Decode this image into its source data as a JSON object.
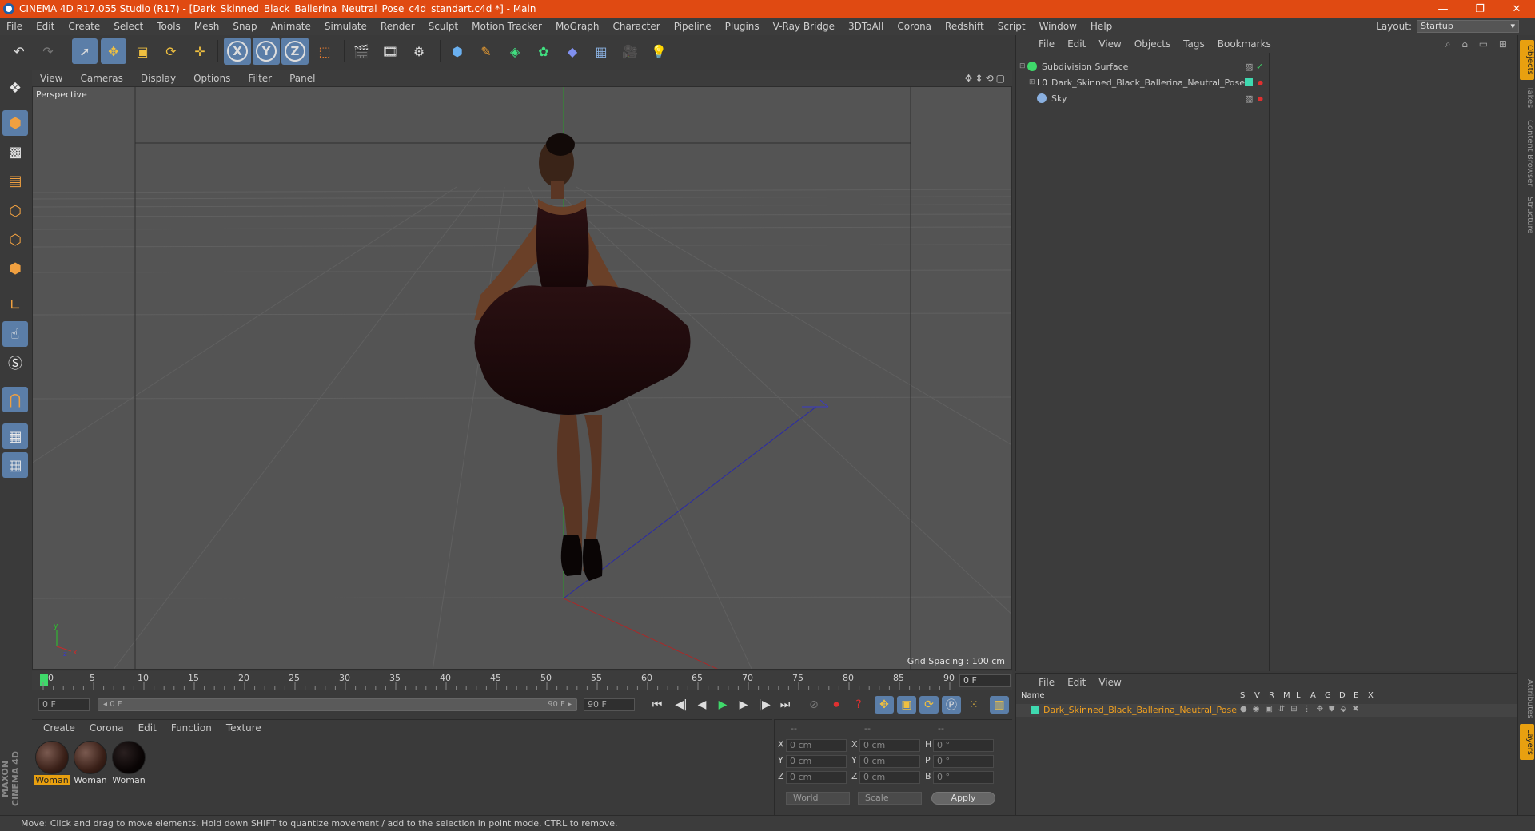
{
  "window": {
    "title": "CINEMA 4D R17.055 Studio (R17) - [Dark_Skinned_Black_Ballerina_Neutral_Pose_c4d_standart.c4d *] - Main",
    "minimize": "—",
    "restore": "❐",
    "close": "✕"
  },
  "menubar": {
    "items": [
      "File",
      "Edit",
      "Create",
      "Select",
      "Tools",
      "Mesh",
      "Snap",
      "Animate",
      "Simulate",
      "Render",
      "Sculpt",
      "Motion Tracker",
      "MoGraph",
      "Character",
      "Pipeline",
      "Plugins",
      "V-Ray Bridge",
      "3DToAll",
      "Corona",
      "Redshift",
      "Script",
      "Window",
      "Help"
    ],
    "layout_label": "Layout:",
    "layout_value": "Startup"
  },
  "viewport": {
    "menu": [
      "View",
      "Cameras",
      "Display",
      "Options",
      "Filter",
      "Panel"
    ],
    "nav_icons": "✥⇕⟲▢",
    "camera_label": "Perspective",
    "grid_spacing": "Grid Spacing : 100 cm"
  },
  "timeline": {
    "ticks": [
      "0",
      "5",
      "10",
      "15",
      "20",
      "25",
      "30",
      "35",
      "40",
      "45",
      "50",
      "55",
      "60",
      "65",
      "70",
      "75",
      "80",
      "85",
      "90"
    ],
    "current_frame": "0 F"
  },
  "transport": {
    "start_field": "0 F",
    "range_start": "◂ 0 F",
    "range_end": "90 F ▸",
    "end_field": "90 F"
  },
  "material_manager": {
    "menu": [
      "Create",
      "Corona",
      "Edit",
      "Function",
      "Texture"
    ],
    "materials": [
      {
        "name": "Woman"
      },
      {
        "name": "Woman"
      },
      {
        "name": "Woman"
      }
    ]
  },
  "coordinates": {
    "headers": [
      "--",
      "--",
      "--"
    ],
    "rows": [
      {
        "axis": "X",
        "pos": "0 cm",
        "axis2": "X",
        "size": "0 cm",
        "axis3": "H",
        "rot": "0 °"
      },
      {
        "axis": "Y",
        "pos": "0 cm",
        "axis2": "Y",
        "size": "0 cm",
        "axis3": "P",
        "rot": "0 °"
      },
      {
        "axis": "Z",
        "pos": "0 cm",
        "axis2": "Z",
        "size": "0 cm",
        "axis3": "B",
        "rot": "0 °"
      }
    ],
    "mode": "World",
    "scale": "Scale",
    "apply": "Apply"
  },
  "object_manager": {
    "menu": [
      "File",
      "Edit",
      "View",
      "Objects",
      "Tags",
      "Bookmarks"
    ],
    "objects": [
      {
        "name": "Subdivision Surface"
      },
      {
        "name": "Dark_Skinned_Black_Ballerina_Neutral_Pose"
      },
      {
        "name": "Sky"
      }
    ]
  },
  "layer_manager": {
    "menu": [
      "File",
      "Edit",
      "View"
    ],
    "col_name": "Name",
    "columns": [
      "S",
      "V",
      "R",
      "M",
      "L",
      "A",
      "G",
      "D",
      "E",
      "X"
    ],
    "layer_name": "Dark_Skinned_Black_Ballerina_Neutral_Pose"
  },
  "side_tabs": [
    "Objects",
    "Takes",
    "Content Browser",
    "Structure"
  ],
  "side_tabs_lower": [
    "Attributes",
    "Layers"
  ],
  "maxon_logo": "MAXON CINEMA 4D",
  "statusbar": "Move: Click and drag to move elements. Hold down SHIFT to quantize movement / add to the selection in point mode, CTRL to remove.",
  "colors": {
    "titlebar": "#e04a12",
    "accent": "#5b7ea8",
    "selection": "#e8a010",
    "layer_color": "#3fd9b0"
  }
}
